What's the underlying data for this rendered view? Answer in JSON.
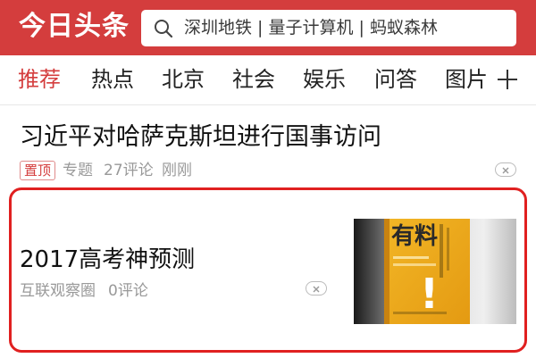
{
  "app": {
    "logo": "今日头条",
    "brand_color": "#d43d3d"
  },
  "search": {
    "text": "深圳地铁 | 量子计算机 | 蚂蚁森林",
    "icon": "search-icon"
  },
  "tabs": [
    {
      "label": "推荐",
      "active": true
    },
    {
      "label": "热点",
      "active": false
    },
    {
      "label": "北京",
      "active": false
    },
    {
      "label": "社会",
      "active": false
    },
    {
      "label": "娱乐",
      "active": false
    },
    {
      "label": "问答",
      "active": false
    },
    {
      "label": "图片",
      "active": false
    }
  ],
  "add_tab_icon": "plus-icon",
  "articles": [
    {
      "title": "习近平对哈萨克斯坦进行国事访问",
      "badge": "置顶",
      "source": "专题",
      "comments": "27评论",
      "time": "刚刚"
    },
    {
      "title": "2017高考神预测",
      "source": "互联观察圈",
      "comments": "0评论",
      "thumbnail": {
        "big_text": "有料",
        "mark": "!"
      }
    }
  ],
  "highlight_color": "#e02020"
}
